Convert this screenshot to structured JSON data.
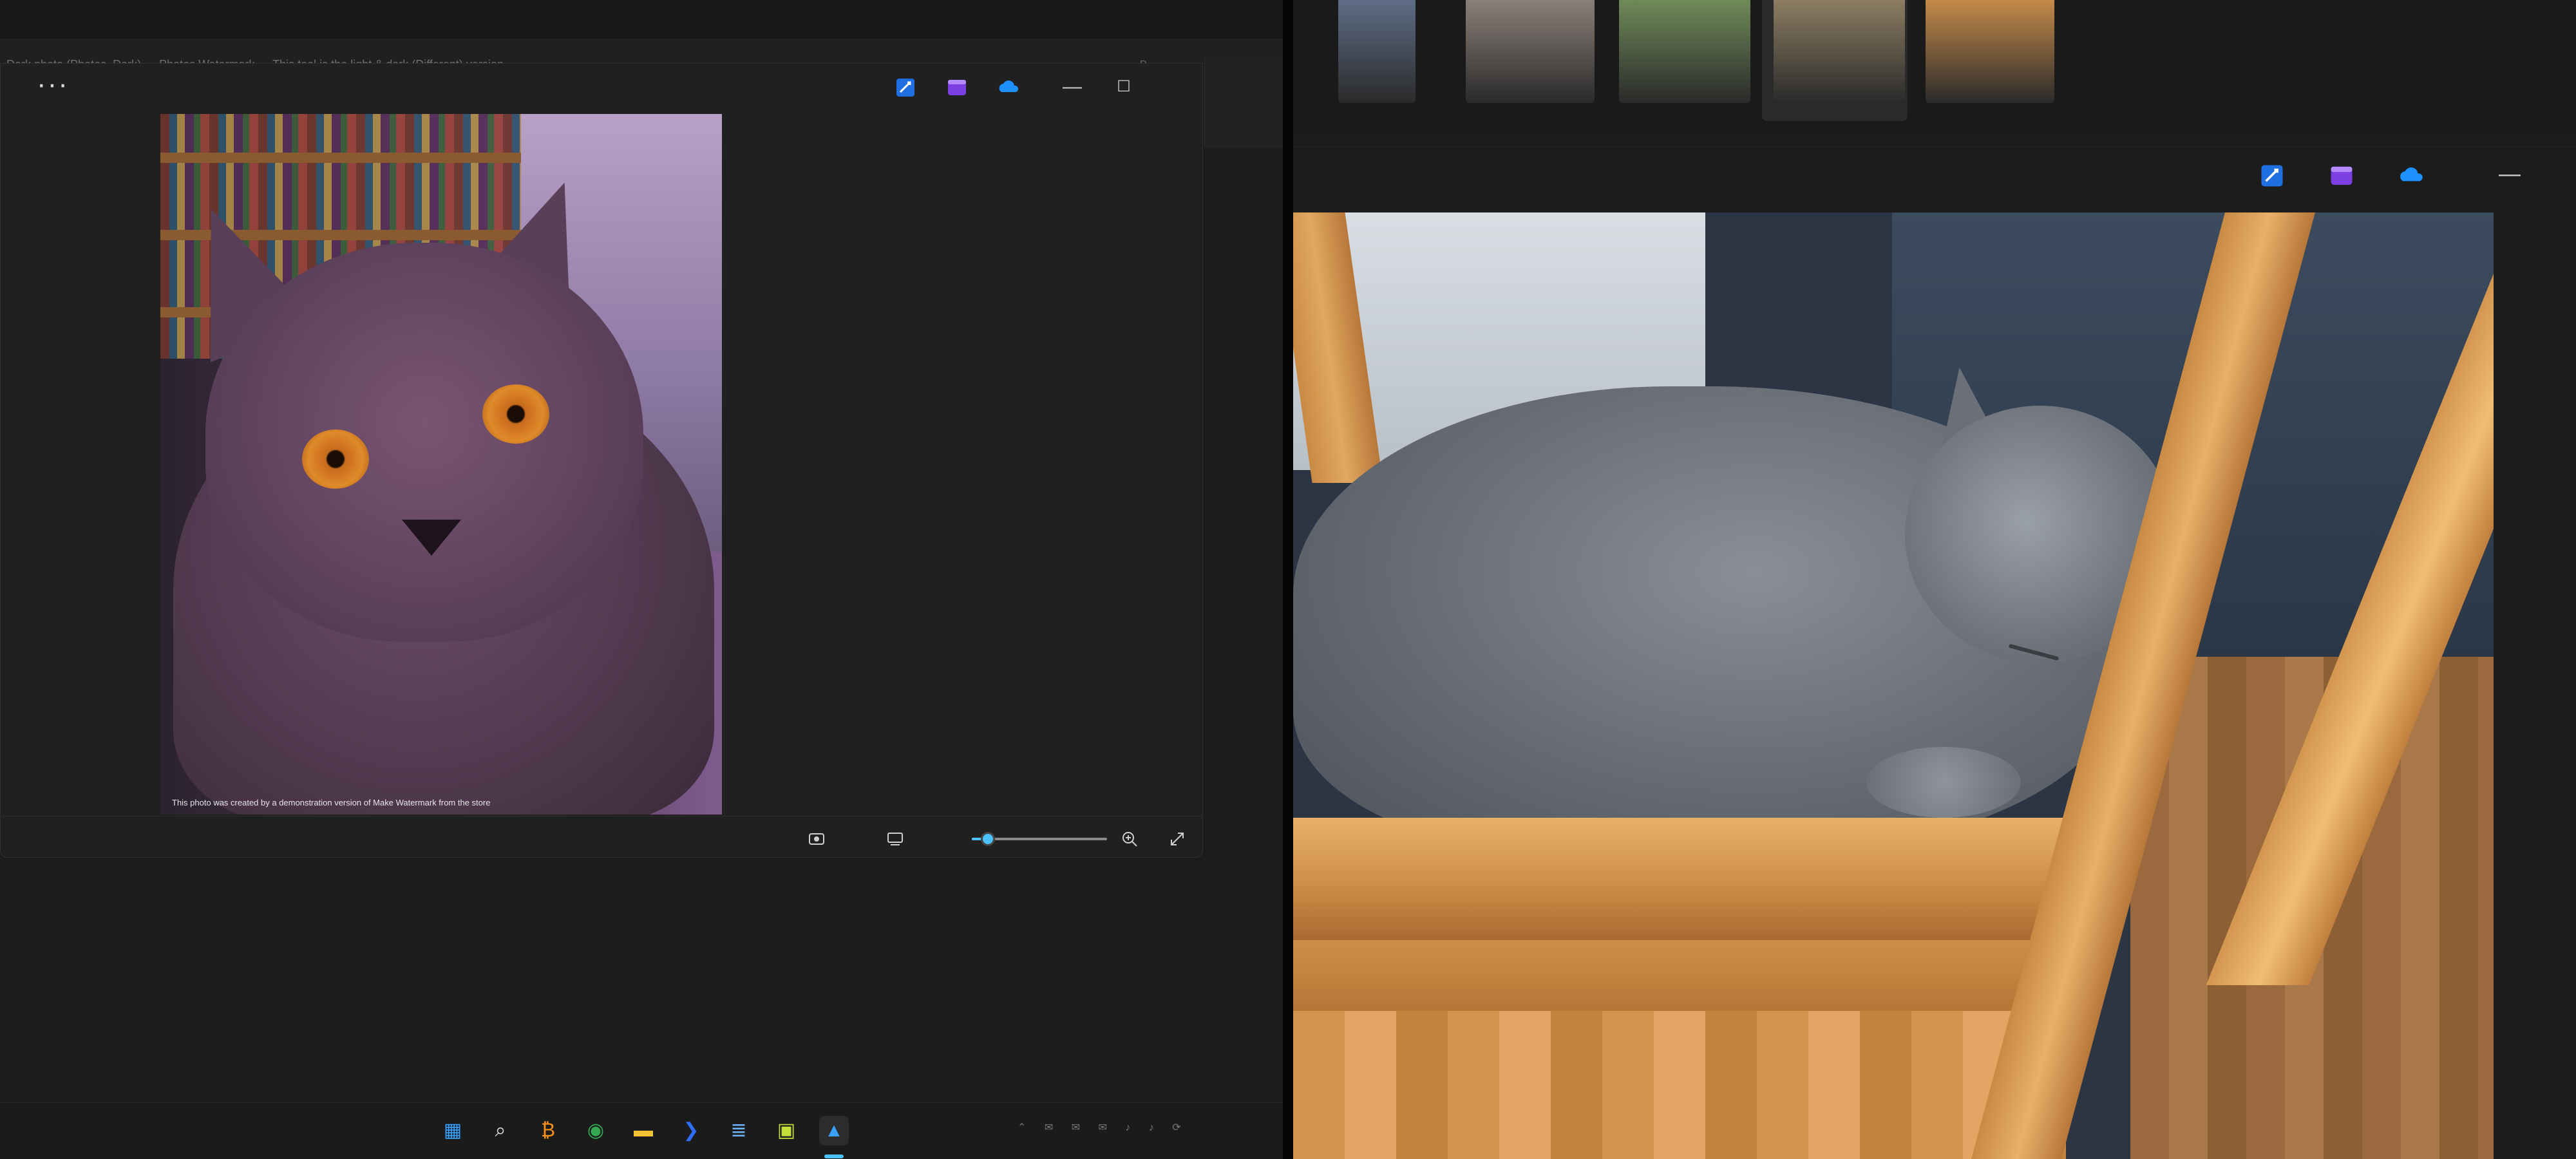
{
  "left_window": {
    "title": "Dark photo (Photos, Dark) — Photos Watermark — This tool is the light & dark (Different) version",
    "dim_text": "P...",
    "more_label": "···",
    "toolbar_icons": [
      "edit-image-icon",
      "clipchamp-icon",
      "onedrive-icon"
    ],
    "minimize_label": "—",
    "maximize_label": "☐",
    "watermark_text": "This photo was created by a demonstration version of Make Watermark from the store",
    "bottom_icons": [
      "screenshot-icon",
      "filmstrip-toggle-icon",
      "zoom-in-icon",
      "fullscreen-icon"
    ],
    "zoom_level_fraction": 0.12
  },
  "taskbar": {
    "icons": [
      {
        "name": "start-icon",
        "glyph": "▦",
        "color": "#3aa0ff"
      },
      {
        "name": "search-icon",
        "glyph": "⌕",
        "color": "#e0e0e0"
      },
      {
        "name": "bitcoin-app-icon",
        "glyph": "₿",
        "color": "#f7931a"
      },
      {
        "name": "chrome-icon",
        "glyph": "◉",
        "color": "#34a853"
      },
      {
        "name": "file-explorer-icon",
        "glyph": "▬",
        "color": "#f2c230"
      },
      {
        "name": "power-automate-icon",
        "glyph": "❯",
        "color": "#2f6df6"
      },
      {
        "name": "notepad-icon",
        "glyph": "≣",
        "color": "#6fb4ff"
      },
      {
        "name": "pycharm-icon",
        "glyph": "▣",
        "color": "#c3e03a"
      },
      {
        "name": "photos-icon",
        "glyph": "▲",
        "color": "#3aa0ff"
      }
    ],
    "active_app": "photos-icon",
    "tray_text": "⌃ ✉ ✉ ✉ ♪ ♪ ⟳"
  },
  "right_window": {
    "filmstrip": [
      {
        "name": "thumb-person",
        "color": "#5e6d86"
      },
      {
        "name": "thumb-room",
        "color": "#8a7f78"
      },
      {
        "name": "thumb-landscape",
        "color": "#6f8a58"
      },
      {
        "name": "thumb-castle",
        "color": "#8c7d62"
      },
      {
        "name": "thumb-sleeping-cat",
        "color": "#c48a4a"
      }
    ],
    "toolbar_icons": [
      "edit-image-icon",
      "clipchamp-icon",
      "onedrive-icon"
    ],
    "minimize_label": "—"
  }
}
